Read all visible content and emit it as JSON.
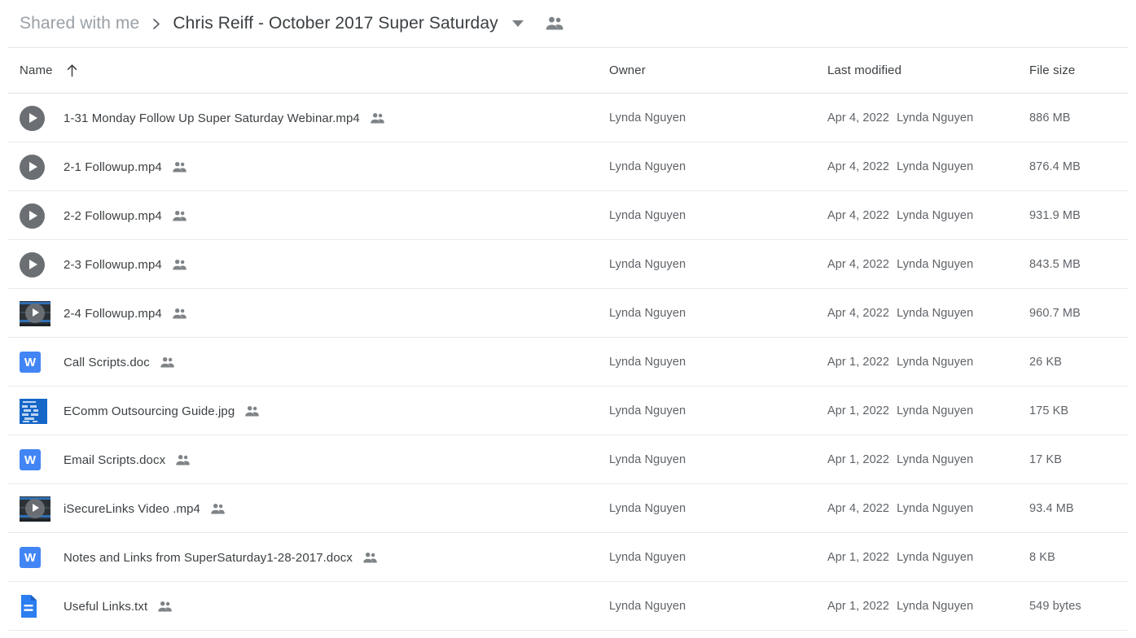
{
  "breadcrumb": {
    "parent": "Shared with me",
    "separator": "›",
    "current": "Chris Reiff - October 2017 Super Saturday",
    "caret_icon": "chevron-down-icon",
    "people_icon": "people-shared-icon"
  },
  "columns": {
    "name": "Name",
    "sort_icon": "arrow-up-icon",
    "owner": "Owner",
    "last_modified": "Last modified",
    "file_size": "File size"
  },
  "files": [
    {
      "name": "1-31 Monday Follow Up Super Saturday Webinar.mp4",
      "icon": "video-circle-icon",
      "shared": true,
      "owner": "Lynda Nguyen",
      "modified_date": "Apr 4, 2022",
      "modified_by": "Lynda Nguyen",
      "size": "886 MB"
    },
    {
      "name": "2-1 Followup.mp4",
      "icon": "video-circle-icon",
      "shared": true,
      "owner": "Lynda Nguyen",
      "modified_date": "Apr 4, 2022",
      "modified_by": "Lynda Nguyen",
      "size": "876.4 MB"
    },
    {
      "name": "2-2 Followup.mp4",
      "icon": "video-circle-icon",
      "shared": true,
      "owner": "Lynda Nguyen",
      "modified_date": "Apr 4, 2022",
      "modified_by": "Lynda Nguyen",
      "size": "931.9 MB"
    },
    {
      "name": "2-3 Followup.mp4",
      "icon": "video-circle-icon",
      "shared": true,
      "owner": "Lynda Nguyen",
      "modified_date": "Apr 4, 2022",
      "modified_by": "Lynda Nguyen",
      "size": "843.5 MB"
    },
    {
      "name": "2-4 Followup.mp4",
      "icon": "video-thumbnail-icon",
      "shared": true,
      "owner": "Lynda Nguyen",
      "modified_date": "Apr 4, 2022",
      "modified_by": "Lynda Nguyen",
      "size": "960.7 MB"
    },
    {
      "name": "Call Scripts.doc",
      "icon": "word-doc-icon",
      "shared": true,
      "owner": "Lynda Nguyen",
      "modified_date": "Apr 1, 2022",
      "modified_by": "Lynda Nguyen",
      "size": "26 KB"
    },
    {
      "name": "EComm Outsourcing Guide.jpg",
      "icon": "image-thumbnail-icon",
      "shared": true,
      "owner": "Lynda Nguyen",
      "modified_date": "Apr 1, 2022",
      "modified_by": "Lynda Nguyen",
      "size": "175 KB"
    },
    {
      "name": "Email Scripts.docx",
      "icon": "word-doc-icon",
      "shared": true,
      "owner": "Lynda Nguyen",
      "modified_date": "Apr 1, 2022",
      "modified_by": "Lynda Nguyen",
      "size": "17 KB"
    },
    {
      "name": "iSecureLinks Video .mp4",
      "icon": "video-thumbnail-icon",
      "shared": true,
      "owner": "Lynda Nguyen",
      "modified_date": "Apr 4, 2022",
      "modified_by": "Lynda Nguyen",
      "size": "93.4 MB"
    },
    {
      "name": "Notes and Links from SuperSaturday1-28-2017.docx",
      "icon": "word-doc-icon",
      "shared": true,
      "owner": "Lynda Nguyen",
      "modified_date": "Apr 1, 2022",
      "modified_by": "Lynda Nguyen",
      "size": "8 KB"
    },
    {
      "name": "Useful Links.txt",
      "icon": "text-file-icon",
      "shared": true,
      "owner": "Lynda Nguyen",
      "modified_date": "Apr 1, 2022",
      "modified_by": "Lynda Nguyen",
      "size": "549 bytes"
    }
  ],
  "colors": {
    "accent_blue": "#4285f4",
    "text_primary": "#3c4043",
    "text_secondary": "#5f6368",
    "text_muted": "#9aa0a6",
    "divider": "#e8eaec"
  },
  "word_icon_letter": "W"
}
